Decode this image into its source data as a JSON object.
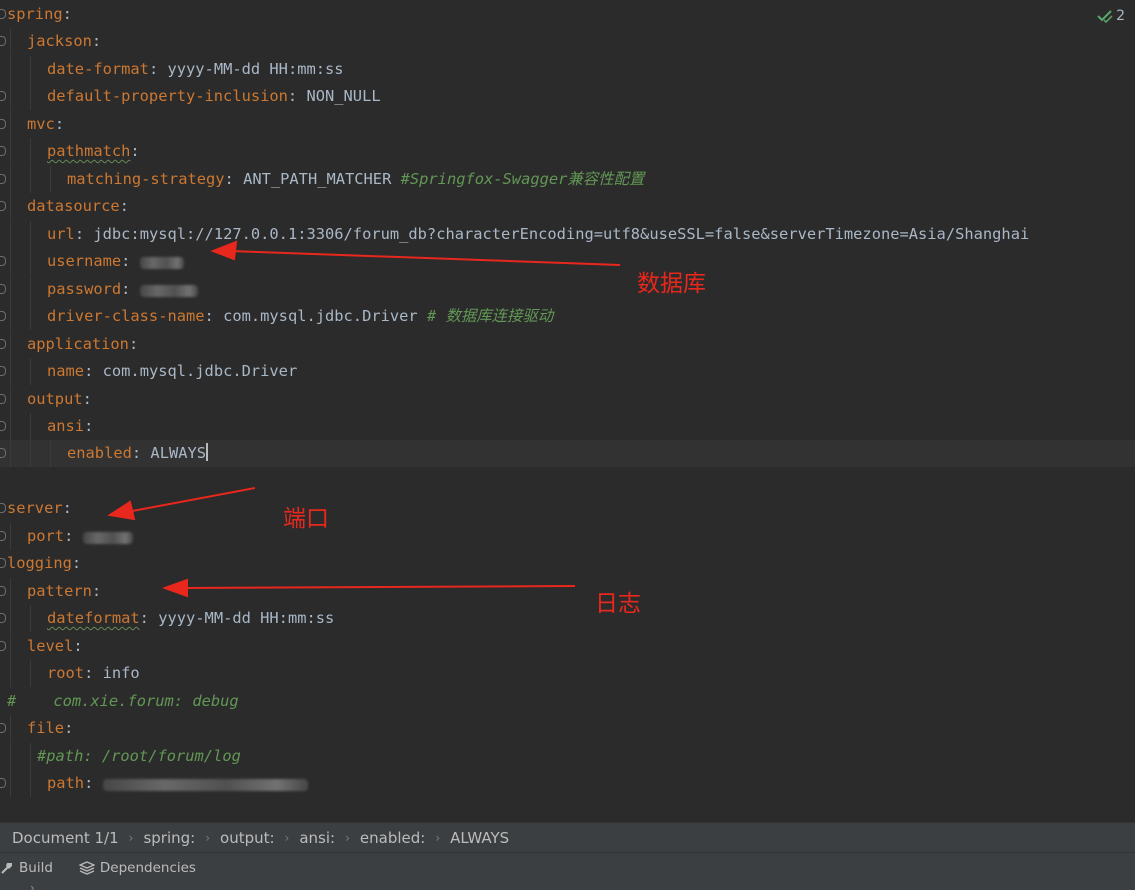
{
  "editor": {
    "lines": [
      {
        "key": "spring",
        "sep": ":"
      },
      {
        "key": "jackson",
        "sep": ":"
      },
      {
        "key": "date-format",
        "sep": ": ",
        "value": "yyyy-MM-dd HH:mm:ss"
      },
      {
        "key": "default-property-inclusion",
        "sep": ": ",
        "value": "NON_NULL"
      },
      {
        "key": "mvc",
        "sep": ":"
      },
      {
        "key": "pathmatch",
        "sep": ":"
      },
      {
        "key": "matching-strategy",
        "sep": ": ",
        "value": "ANT_PATH_MATCHER ",
        "comment": "#Springfox-Swagger兼容性配置"
      },
      {
        "key": "datasource",
        "sep": ":"
      },
      {
        "key": "url",
        "sep": ": ",
        "value": "jdbc:mysql://127.0.0.1:3306/forum_db?characterEncoding=utf8&useSSL=false&serverTimezone=Asia/Shanghai"
      },
      {
        "key": "username",
        "sep": ": "
      },
      {
        "key": "password",
        "sep": ": "
      },
      {
        "key": "driver-class-name",
        "sep": ": ",
        "value": "com.mysql.jdbc.Driver ",
        "comment": "# 数据库连接驱动"
      },
      {
        "key": "application",
        "sep": ":"
      },
      {
        "key": "name",
        "sep": ": ",
        "value": "com.mysql.jdbc.Driver"
      },
      {
        "key": "output",
        "sep": ":"
      },
      {
        "key": "ansi",
        "sep": ":"
      },
      {
        "key": "enabled",
        "sep": ": ",
        "value": "ALWAYS"
      },
      {
        "key": "server",
        "sep": ":"
      },
      {
        "key": "port",
        "sep": ": "
      },
      {
        "key": "logging",
        "sep": ":"
      },
      {
        "key": "pattern",
        "sep": ":"
      },
      {
        "key": "dateformat",
        "sep": ": ",
        "value": "yyyy-MM-dd HH:mm:ss"
      },
      {
        "key": "level",
        "sep": ":"
      },
      {
        "key": "root",
        "sep": ": ",
        "value": "info"
      },
      {
        "comment": "#    com.xie.forum: debug"
      },
      {
        "key": "file",
        "sep": ":"
      },
      {
        "comment": "#path: /root/forum/log"
      },
      {
        "key": "path",
        "sep": ": "
      }
    ]
  },
  "inspection": {
    "count": "2"
  },
  "annotations": {
    "database": "数据库",
    "port": "端口",
    "log": "日志"
  },
  "breadcrumb": {
    "items": [
      "Document 1/1",
      "spring:",
      "output:",
      "ansi:",
      "enabled:",
      "ALWAYS"
    ]
  },
  "toolwindow": {
    "build": "Build",
    "dependencies": "Dependencies"
  },
  "colors": {
    "key": "#cc7832",
    "value": "#a9b7c6",
    "comment": "#629755",
    "background": "#2b2b2b",
    "annotation": "#e8271d"
  }
}
